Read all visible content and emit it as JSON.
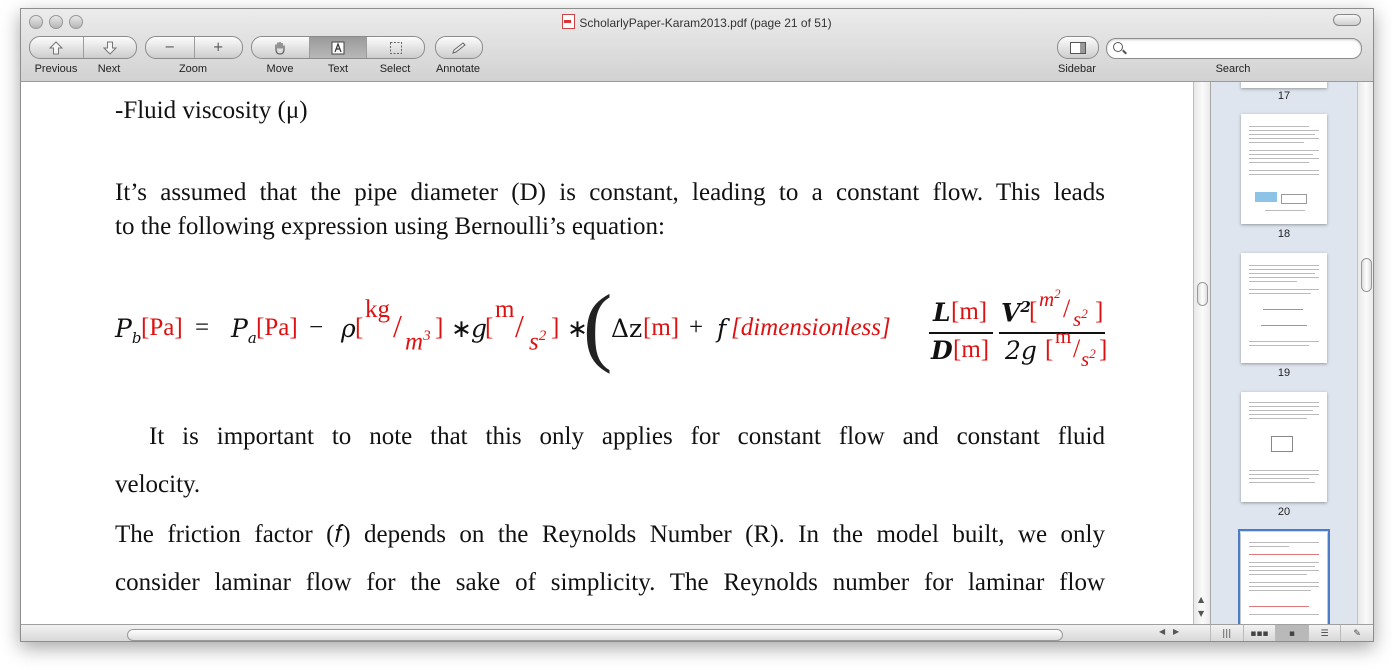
{
  "window": {
    "title": "ScholarlyPaper-Karam2013.pdf (page 21 of 51)"
  },
  "toolbar": {
    "previous_label": "Previous",
    "next_label": "Next",
    "zoom_label": "Zoom",
    "move_label": "Move",
    "text_label": "Text",
    "select_label": "Select",
    "annotate_label": "Annotate",
    "sidebar_label": "Sidebar",
    "search_label": "Search",
    "search_value": "",
    "zoom_out_symbol": "−",
    "zoom_in_symbol": "+"
  },
  "document": {
    "line1": "-Fluid viscosity (μ)",
    "para1_line1": "It’s assumed that the pipe diameter (D) is constant, leading to a constant flow. This leads",
    "para1_line2": "to the following expression using Bernoulli’s equation:",
    "para2_line1": "It is important to note that this only applies for constant flow and constant fluid",
    "para2_line2": "velocity.",
    "para3_line1": "The friction factor (𝑓) depends on the Reynolds Number (R). In the model built, we only",
    "para3_line2": "consider laminar flow for the sake of simplicity. The Reynolds number for laminar flow"
  },
  "equation": {
    "pb": "P",
    "pb_sub": "b",
    "pa_unit": "[Pa]",
    "equals": "=",
    "pa": "P",
    "pa_sub": "a",
    "minus": "−",
    "rho": "ρ",
    "unit_kg": "kg",
    "unit_m3": "m",
    "exp3": "3",
    "times": "∗",
    "g": "g",
    "unit_m": "m",
    "unit_s": "s",
    "exp2": "2",
    "lparen": "(",
    "dz": "Δz",
    "unit_m_br": "[m]",
    "plus": "+",
    "f": "f",
    "dimensionless": "[dimensionless]",
    "L": "L",
    "D": "D",
    "V": "V",
    "twog": "2g",
    "open_br": "[",
    "close_br": "]",
    "slash": "/"
  },
  "sidebar": {
    "pages": [
      "17",
      "18",
      "19",
      "20"
    ]
  }
}
